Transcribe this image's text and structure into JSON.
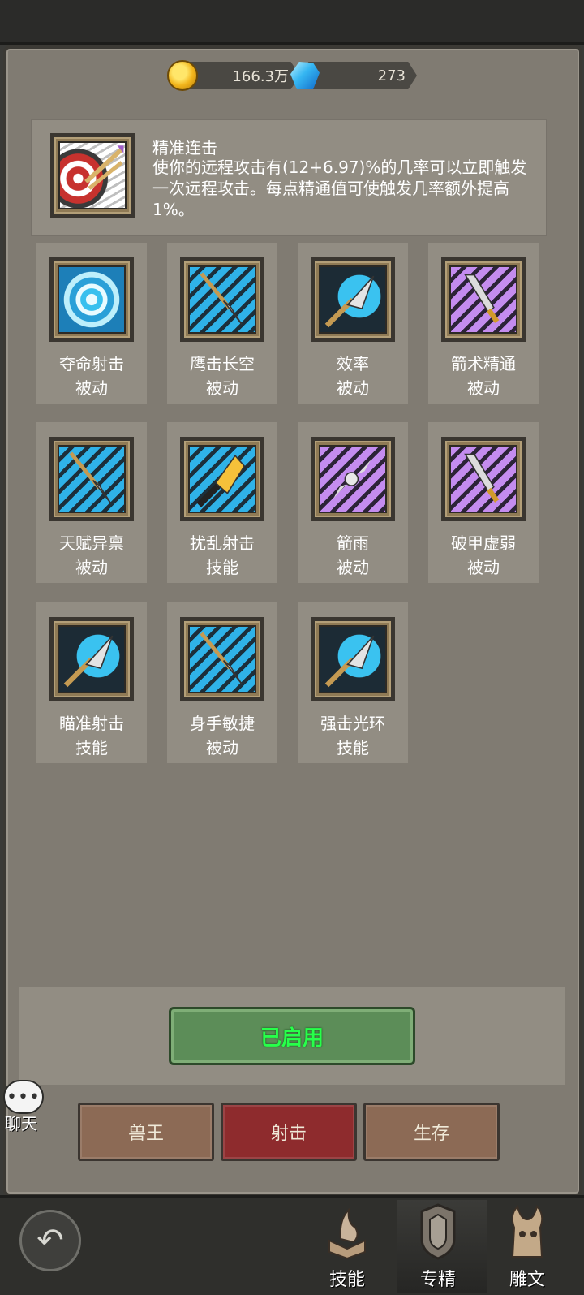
{
  "currency": {
    "gold": "166.3万",
    "gems": "273"
  },
  "selected_skill": {
    "title": "精准连击",
    "description": "使你的远程攻击有(12+6.97)%的几率可以立即触发一次远程攻击。每点精通值可使触发几率额外提高1%。"
  },
  "skills": [
    {
      "name": "夺命射击",
      "type": "被动",
      "icon": "swirl-icon"
    },
    {
      "name": "鹰击长空",
      "type": "被动",
      "icon": "spear-icon"
    },
    {
      "name": "效率",
      "type": "被动",
      "icon": "arrowhead-icon"
    },
    {
      "name": "箭术精通",
      "type": "被动",
      "icon": "dagger-icon"
    },
    {
      "name": "天赋异禀",
      "type": "被动",
      "icon": "spear-icon"
    },
    {
      "name": "扰乱射击",
      "type": "技能",
      "icon": "crystal-arrow-icon"
    },
    {
      "name": "箭雨",
      "type": "被动",
      "icon": "arrows-skull-icon"
    },
    {
      "name": "破甲虚弱",
      "type": "被动",
      "icon": "dagger-icon"
    },
    {
      "name": "瞄准射击",
      "type": "技能",
      "icon": "arrowhead-icon"
    },
    {
      "name": "身手敏捷",
      "type": "被动",
      "icon": "spear-icon"
    },
    {
      "name": "强击光环",
      "type": "技能",
      "icon": "arrowhead-icon"
    }
  ],
  "enable_button": "已启用",
  "spec_tabs": [
    "兽王",
    "射击",
    "生存"
  ],
  "active_spec_tab": "射击",
  "chat": {
    "bubble": "•••",
    "label": "聊天"
  },
  "nav": {
    "items": [
      "技能",
      "专精",
      "雕文"
    ],
    "active": "专精"
  },
  "colors": {
    "panel": "#807b72",
    "card": "#928d83",
    "enable_green": "#5c8d58",
    "enable_text": "#27ff4a",
    "tab_brown": "#8c6a55",
    "tab_red": "#8e2b2d"
  }
}
